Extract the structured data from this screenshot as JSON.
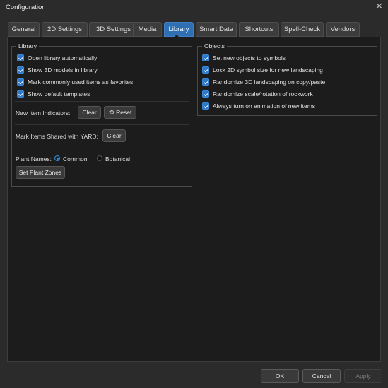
{
  "window": {
    "title": "Configuration",
    "close_icon": "close-icon"
  },
  "tabs": [
    {
      "label": "General",
      "active": false
    },
    {
      "label": "2D Settings",
      "active": false
    },
    {
      "label": "3D Settings",
      "active": false
    },
    {
      "label": "Media",
      "active": false
    },
    {
      "label": "Library",
      "active": true
    },
    {
      "label": "Smart Data",
      "active": false
    },
    {
      "label": "Shortcuts",
      "active": false
    },
    {
      "label": "Spell-Check",
      "active": false
    },
    {
      "label": "Vendors",
      "active": false
    }
  ],
  "library": {
    "title": "Library",
    "checks": [
      {
        "label": "Open library automatically",
        "checked": true
      },
      {
        "label": "Show 3D models in library",
        "checked": true
      },
      {
        "label": "Mark commonly used items as favorites",
        "checked": true
      },
      {
        "label": "Show default templates",
        "checked": true
      }
    ],
    "indicators_label": "New Item Indicators:",
    "clear_label": "Clear",
    "reset_label": "Reset",
    "yard_label": "Mark Items Shared with YARD:",
    "yard_clear_label": "Clear",
    "plant_names_label": "Plant Names:",
    "plant_names_options": [
      {
        "label": "Common",
        "selected": true
      },
      {
        "label": "Botanical",
        "selected": false
      }
    ],
    "plant_zones_label": "Set Plant Zones"
  },
  "objects": {
    "title": "Objects",
    "checks": [
      {
        "label": "Set new objects to symbols",
        "checked": true
      },
      {
        "label": "Lock 2D symbol size for new landscaping",
        "checked": true
      },
      {
        "label": "Randomize 3D landscaping on copy/paste",
        "checked": true
      },
      {
        "label": "Randomize scale/rotation of rockwork",
        "checked": true
      },
      {
        "label": "Always turn on animation of new items",
        "checked": true
      }
    ]
  },
  "footer": {
    "ok_label": "OK",
    "cancel_label": "Cancel",
    "apply_label": "Apply"
  },
  "colors": {
    "accent": "#2f78c8",
    "active_tab": "#2f6fb3",
    "panel_bg": "#1c1c1c",
    "window_bg": "#2b2b2b"
  }
}
